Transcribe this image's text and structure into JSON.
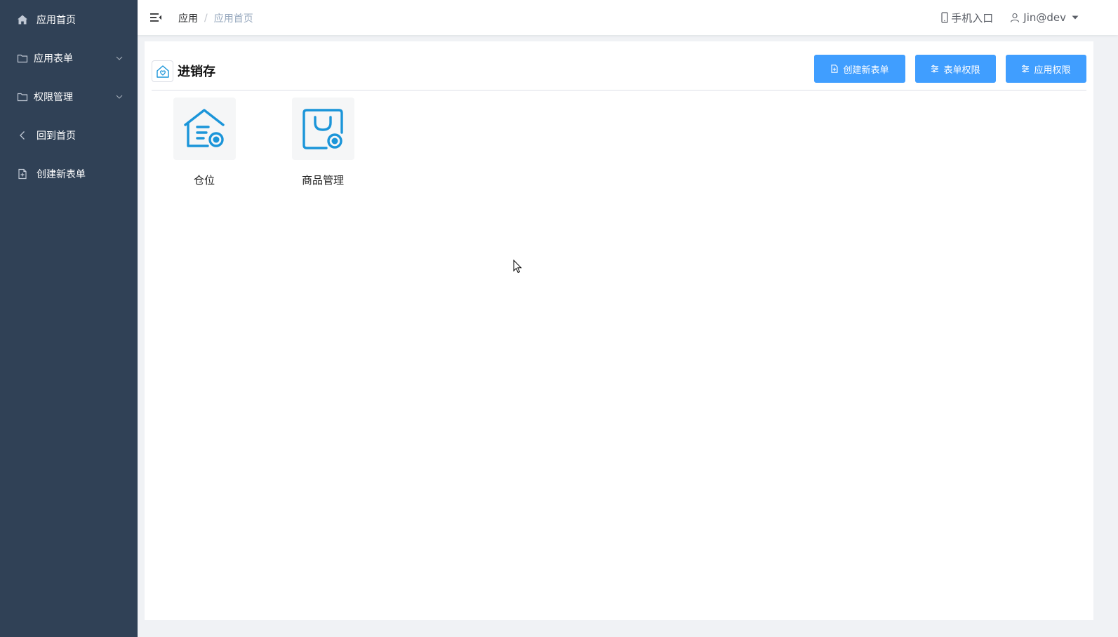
{
  "sidebar": {
    "items": [
      {
        "label": "应用首页",
        "icon": "home-icon"
      },
      {
        "label": "应用表单",
        "icon": "folder-icon",
        "expandable": true
      },
      {
        "label": "权限管理",
        "icon": "folder-icon",
        "expandable": true
      },
      {
        "label": "回到首页",
        "icon": "back-arrow-icon"
      },
      {
        "label": "创建新表单",
        "icon": "add-document-icon"
      }
    ]
  },
  "header": {
    "breadcrumb": {
      "root": "应用",
      "separator": "/",
      "current": "应用首页"
    },
    "mobile_entry": "手机入口",
    "user": "Jin@dev"
  },
  "main": {
    "app_title": "进销存",
    "buttons": {
      "create_form": "创建新表单",
      "form_permission": "表单权限",
      "app_permission": "应用权限"
    },
    "forms": [
      {
        "label": "仓位",
        "icon": "warehouse-icon"
      },
      {
        "label": "商品管理",
        "icon": "shopping-bag-icon"
      }
    ]
  },
  "colors": {
    "sidebar_bg": "#304156",
    "primary": "#409eff",
    "icon_blue": "#1b95d9"
  }
}
